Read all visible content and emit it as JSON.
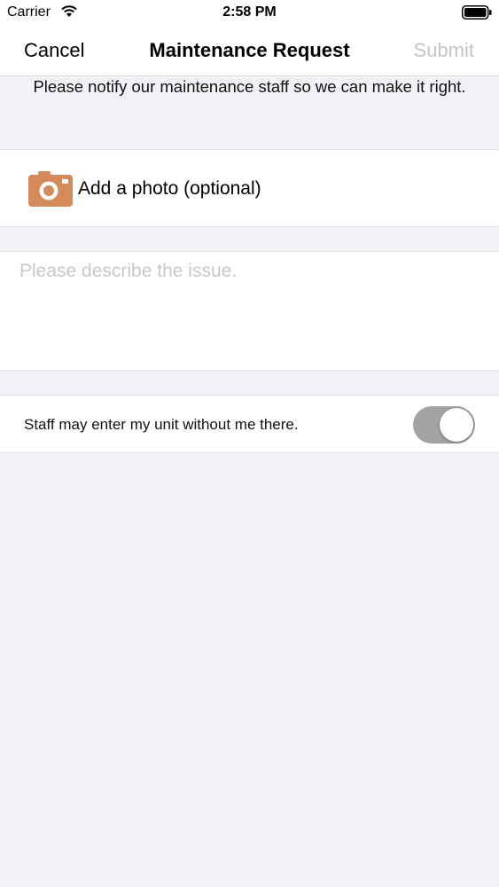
{
  "status_bar": {
    "carrier": "Carrier",
    "time": "2:58 PM",
    "wifi_icon": "wifi-icon",
    "battery_icon": "battery-icon"
  },
  "nav": {
    "cancel_label": "Cancel",
    "title": "Maintenance Request",
    "submit_label": "Submit"
  },
  "notice_text": "Please notify our maintenance staff so we can make it right.",
  "photo": {
    "icon": "camera-icon",
    "label": "Add a photo (optional)"
  },
  "description": {
    "placeholder": "Please describe the issue.",
    "value": ""
  },
  "permission": {
    "label": "Staff may enter my unit without me there.",
    "toggle_on": true
  },
  "colors": {
    "background": "#f2f1f6",
    "camera_accent": "#d58a5c",
    "submit_disabled": "#c4c4c8",
    "toggle_track": "#a3a3a6"
  }
}
